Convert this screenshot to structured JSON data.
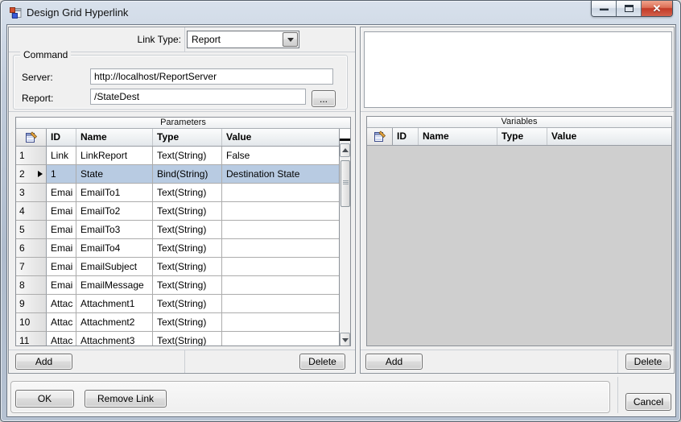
{
  "titlebar": {
    "title": "Design Grid Hyperlink"
  },
  "link_type": {
    "label": "Link Type:",
    "value": "Report"
  },
  "command": {
    "title": "Command",
    "server_label": "Server:",
    "server_value": "http://localhost/ReportServer",
    "report_label": "Report:",
    "report_value": "/StateDest",
    "browse_label": "..."
  },
  "parameters": {
    "caption": "Parameters",
    "columns": [
      "ID",
      "Name",
      "Type",
      "Value"
    ],
    "rows": [
      {
        "num": "1",
        "id": "Link",
        "name": "LinkReport",
        "type": "Text(String)",
        "value": "False",
        "selected": false
      },
      {
        "num": "2",
        "id": "1",
        "name": "State",
        "type": "Bind(String)",
        "value": "Destination State",
        "selected": true
      },
      {
        "num": "3",
        "id": "Emai",
        "name": "EmailTo1",
        "type": "Text(String)",
        "value": "",
        "selected": false
      },
      {
        "num": "4",
        "id": "Emai",
        "name": "EmailTo2",
        "type": "Text(String)",
        "value": "",
        "selected": false
      },
      {
        "num": "5",
        "id": "Emai",
        "name": "EmailTo3",
        "type": "Text(String)",
        "value": "",
        "selected": false
      },
      {
        "num": "6",
        "id": "Emai",
        "name": "EmailTo4",
        "type": "Text(String)",
        "value": "",
        "selected": false
      },
      {
        "num": "7",
        "id": "Emai",
        "name": "EmailSubject",
        "type": "Text(String)",
        "value": "",
        "selected": false
      },
      {
        "num": "8",
        "id": "Emai",
        "name": "EmailMessage",
        "type": "Text(String)",
        "value": "",
        "selected": false
      },
      {
        "num": "9",
        "id": "Attac",
        "name": "Attachment1",
        "type": "Text(String)",
        "value": "",
        "selected": false
      },
      {
        "num": "10",
        "id": "Attac",
        "name": "Attachment2",
        "type": "Text(String)",
        "value": "",
        "selected": false
      },
      {
        "num": "11",
        "id": "Attac",
        "name": "Attachment3",
        "type": "Text(String)",
        "value": "",
        "selected": false
      }
    ],
    "add_label": "Add",
    "delete_label": "Delete"
  },
  "variables": {
    "caption": "Variables",
    "columns": [
      "ID",
      "Name",
      "Type",
      "Value"
    ],
    "rows": [],
    "add_label": "Add",
    "delete_label": "Delete"
  },
  "footer": {
    "ok_label": "OK",
    "remove_link_label": "Remove Link",
    "cancel_label": "Cancel"
  },
  "colors": {
    "selected_row": "#B8CBE2",
    "close_button": "#C23A27",
    "grid_empty": "#CFCFCF"
  }
}
